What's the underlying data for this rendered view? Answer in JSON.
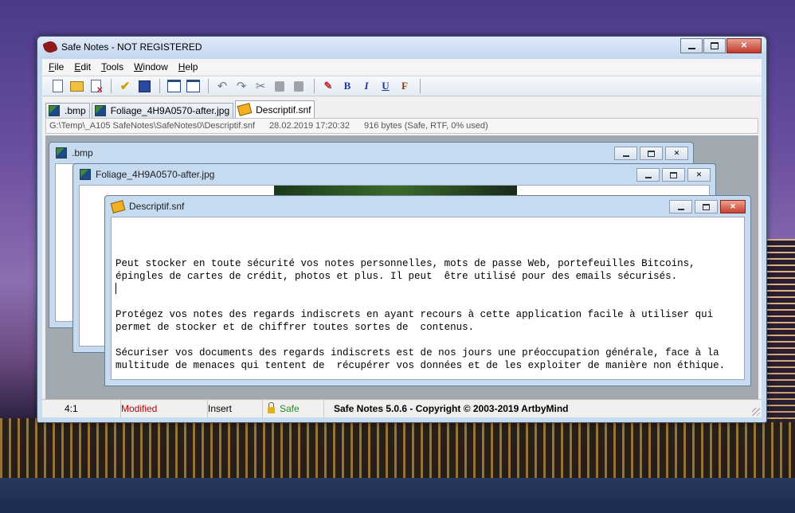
{
  "window": {
    "title": "Safe Notes - NOT REGISTERED"
  },
  "menu": [
    {
      "key": "F",
      "rest": "ile"
    },
    {
      "key": "E",
      "rest": "dit"
    },
    {
      "key": "T",
      "rest": "ools"
    },
    {
      "key": "W",
      "rest": "indow"
    },
    {
      "key": "H",
      "rest": "elp"
    }
  ],
  "toolbar": {
    "bold": "B",
    "italic": "I",
    "underline": "U",
    "font": "F"
  },
  "tabs": [
    {
      "label": ".bmp"
    },
    {
      "label": "Foliage_4H9A0570-after.jpg"
    },
    {
      "label": "Descriptif.snf"
    }
  ],
  "path_bar": {
    "path": "G:\\Temp\\_A105 SafeNotes\\SafeNotes0\\Descriptif.snf",
    "datetime": "28.02.2019 17:20:32",
    "info": "916 bytes (Safe, RTF, 0% used)"
  },
  "children": {
    "bmp": {
      "title": ".bmp"
    },
    "jpg": {
      "title": "Foliage_4H9A0570-after.jpg"
    },
    "snf": {
      "title": "Descriptif.snf"
    }
  },
  "editor": {
    "p1": "Peut stocker en toute sécurité vos notes personnelles, mots de passe Web, portefeuilles Bitcoins, épingles de cartes de crédit, photos et plus. Il peut  être utilisé pour des emails sécurisés.",
    "p2": "Protégez vos notes des regards indiscrets en ayant recours à cette application facile à utiliser qui permet de stocker et de chiffrer toutes sortes de  contenus.",
    "p3": "Sécuriser vos documents des regards indiscrets est de nos jours une préoccupation générale, face à la multitude de menaces qui tentent de  récupérer vos données et de les exploiter de manière non éthique."
  },
  "status": {
    "position": "4:1",
    "modified": "Modified",
    "mode": "Insert",
    "safe": "Safe",
    "copyright": "Safe Notes 5.0.6  -  Copyright © 2003-2019 ArtbyMind"
  },
  "colors": {
    "modified": "#c00000",
    "safe": "#2a8a2a",
    "close_button": "#c0392b"
  }
}
